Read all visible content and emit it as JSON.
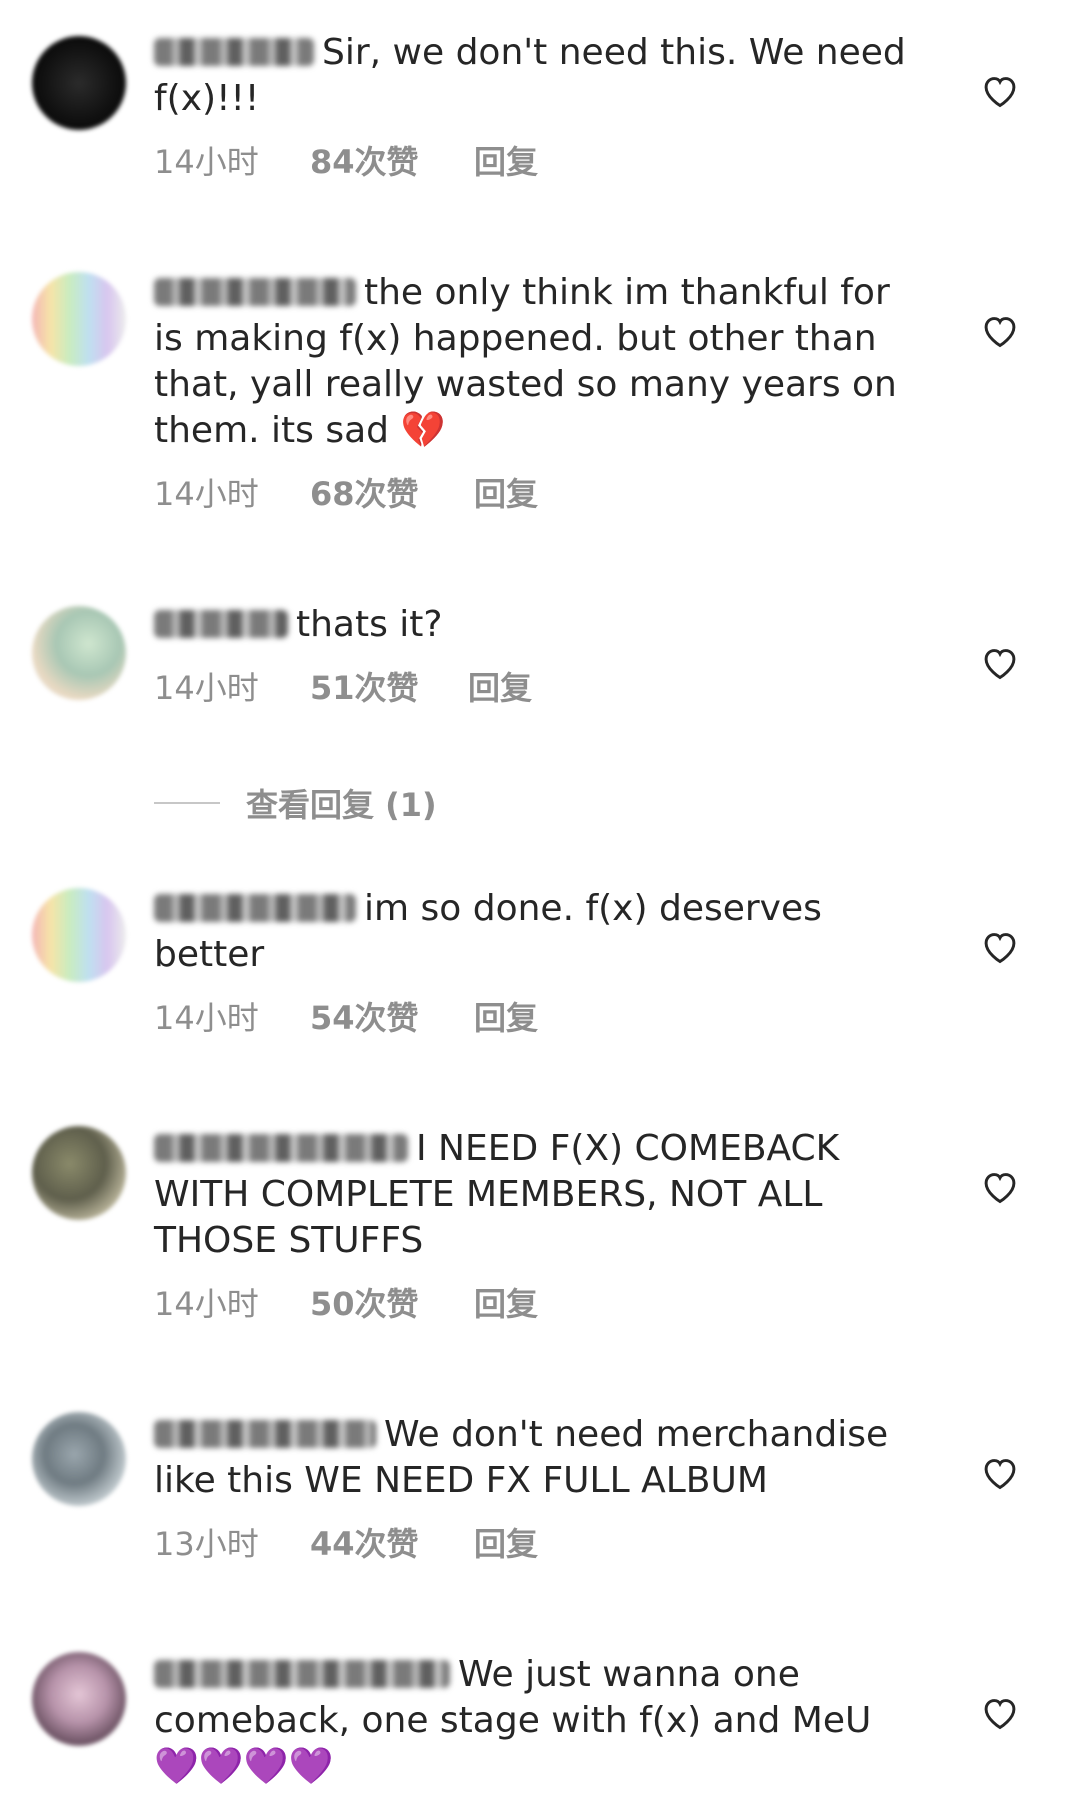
{
  "comments": [
    {
      "text": "Sir, we don't need this. We need f(x)!!!",
      "emoji": "",
      "time": "14小时",
      "likes": "84次赞",
      "reply": "回复"
    },
    {
      "text": "the only think im thankful for is making f(x) happened. but other than that, yall really wasted so many years on them. its sad",
      "emoji": "💔",
      "time": "14小时",
      "likes": "68次赞",
      "reply": "回复"
    },
    {
      "text": "thats it?",
      "emoji": "",
      "time": "14小时",
      "likes": "51次赞",
      "reply": "回复"
    },
    {
      "text": "im so done. f(x) deserves better",
      "emoji": "",
      "time": "14小时",
      "likes": "54次赞",
      "reply": "回复"
    },
    {
      "text": "I NEED F(X) COMEBACK WITH COMPLETE MEMBERS, NOT ALL THOSE STUFFS",
      "emoji": "",
      "time": "14小时",
      "likes": "50次赞",
      "reply": "回复"
    },
    {
      "text": "We don't need merchandise like this WE NEED FX FULL ALBUM",
      "emoji": "",
      "time": "13小时",
      "likes": "44次赞",
      "reply": "回复"
    },
    {
      "text": "We just wanna one comeback, one stage with f(x) and MeU",
      "emoji": "💜💜💜💜",
      "time": "",
      "likes": "",
      "reply": ""
    }
  ],
  "view_replies": "查看回复 (1)",
  "icons": {
    "heart": "heart-outline-icon"
  },
  "colors": {
    "text": "#262626",
    "meta": "#8e8e8e",
    "heart": "#262626"
  }
}
